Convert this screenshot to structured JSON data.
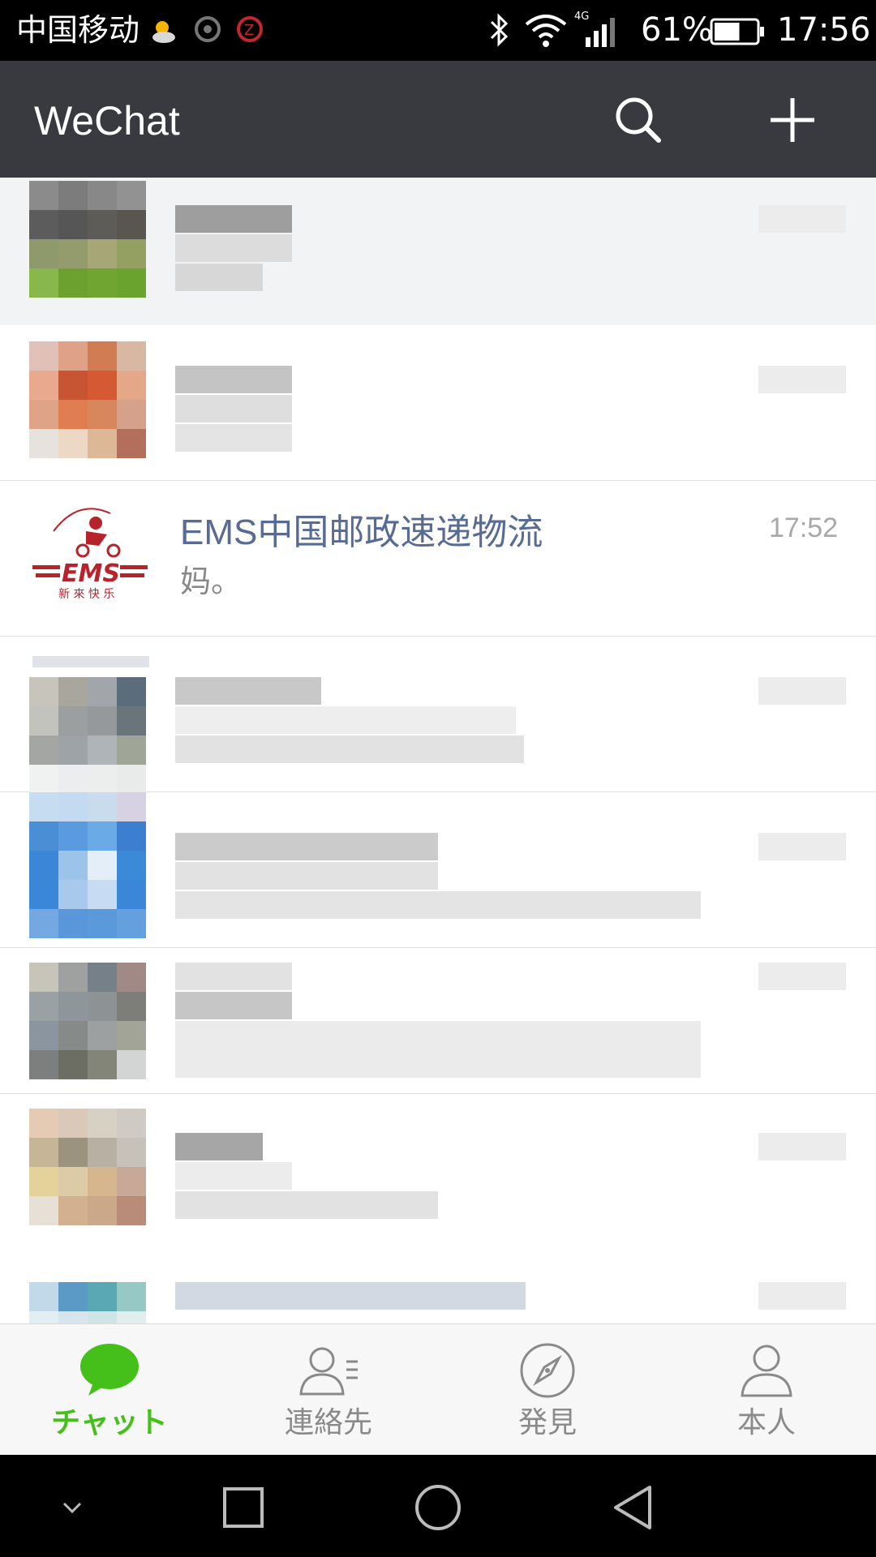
{
  "status_bar": {
    "carrier": "中国移动",
    "network": "4G",
    "battery_percent": "61%",
    "battery_level": 0.61,
    "clock": "17:56",
    "icons": [
      "weather-sun-cloud-icon",
      "app-notification-icon",
      "app-notification-icon",
      "bluetooth-icon",
      "wifi-icon",
      "cell-signal-icon",
      "battery-icon"
    ]
  },
  "header": {
    "title": "WeChat",
    "actions": [
      "search-icon",
      "plus-icon"
    ]
  },
  "chats": [
    {
      "name": "EMS中国邮政速递物流",
      "last_message": "妈。",
      "time": "17:52",
      "avatar": "ems-logo"
    }
  ],
  "tabs": [
    {
      "label": "チャット",
      "icon": "chat-bubble-icon",
      "active": true
    },
    {
      "label": "連絡先",
      "icon": "contacts-icon",
      "active": false
    },
    {
      "label": "発見",
      "icon": "compass-icon",
      "active": false
    },
    {
      "label": "本人",
      "icon": "person-icon",
      "active": false
    }
  ],
  "colors": {
    "header_bg": "#393a3f",
    "accent_green": "#45c01a",
    "chat_name": "#576b95"
  },
  "nav_bar": [
    "chevron-down-icon",
    "square-recents-icon",
    "circle-home-icon",
    "triangle-back-icon"
  ]
}
